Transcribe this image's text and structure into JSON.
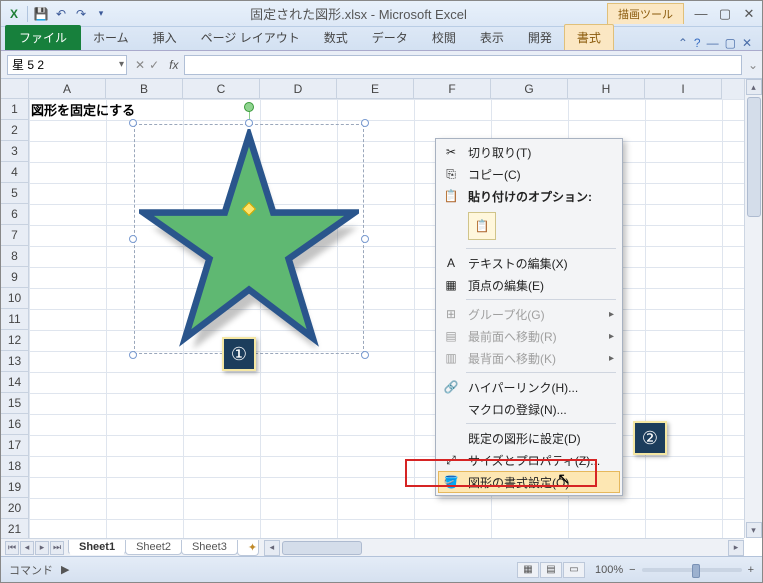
{
  "title": {
    "filename": "固定された図形.xlsx",
    "app": "Microsoft Excel",
    "contextual_tool": "描画ツール"
  },
  "qat": {
    "save": "💾",
    "undo": "↶",
    "redo": "↷"
  },
  "ribbon": {
    "file": "ファイル",
    "tabs": [
      "ホーム",
      "挿入",
      "ページ レイアウト",
      "数式",
      "データ",
      "校閲",
      "表示",
      "開発"
    ],
    "contextual": "書式"
  },
  "namebox": {
    "value": "星 5 2"
  },
  "columns": [
    "A",
    "B",
    "C",
    "D",
    "E",
    "F",
    "G",
    "H",
    "I"
  ],
  "rows": [
    "1",
    "2",
    "3",
    "4",
    "5",
    "6",
    "7",
    "8",
    "9",
    "10",
    "11",
    "12",
    "13",
    "14",
    "15",
    "16",
    "17",
    "18",
    "19",
    "20",
    "21"
  ],
  "cells": {
    "A1": "図形を固定にする"
  },
  "callouts": {
    "one": "①",
    "two": "②"
  },
  "context_menu": {
    "cut": "切り取り(T)",
    "copy": "コピー(C)",
    "paste_options_label": "貼り付けのオプション:",
    "edit_text": "テキストの編集(X)",
    "edit_points": "頂点の編集(E)",
    "group": "グループ化(G)",
    "bring_front": "最前面へ移動(R)",
    "send_back": "最背面へ移動(K)",
    "hyperlink": "ハイパーリンク(H)...",
    "assign_macro": "マクロの登録(N)...",
    "set_default": "既定の図形に設定(D)",
    "size_props": "サイズとプロパティ(Z)...",
    "format_shape": "図形の書式設定(O)..."
  },
  "sheets": {
    "tabs": [
      "Sheet1",
      "Sheet2",
      "Sheet3"
    ]
  },
  "status": {
    "mode": "コマンド",
    "zoom": "100%"
  },
  "shape": {
    "fill": "#5fb872",
    "outline": "#2a558c"
  }
}
